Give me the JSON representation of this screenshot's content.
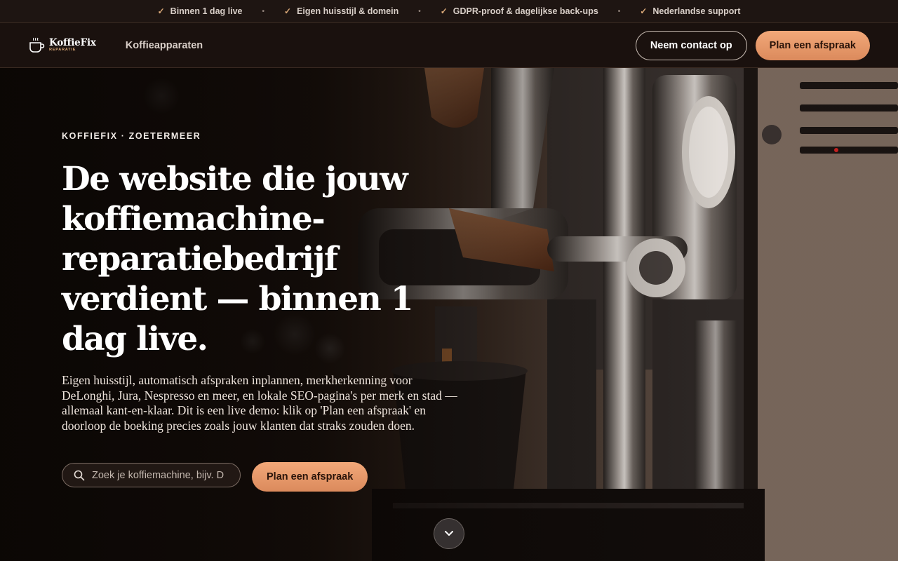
{
  "topbar": {
    "items": [
      "Binnen 1 dag live",
      "Eigen huisstijl & domein",
      "GDPR-proof & dagelijkse back-ups",
      "Nederlandse support"
    ],
    "separator": "•"
  },
  "nav": {
    "logo_name": "KoffieFix",
    "logo_sub": "REPARATIE",
    "link": "Koffieapparaten",
    "contact_label": "Neem contact op",
    "cta_label": "Plan een afspraak"
  },
  "hero": {
    "eyebrow": "KOFFIEFIX · ZOETERMEER",
    "headline": "De website die jouw koffiemachine-reparatiebedrijf verdient — binnen 1 dag live.",
    "lead": "Eigen huisstijl, automatisch afspraken inplannen, merkherkenning voor DeLonghi, Jura, Nespresso en meer, en lokale SEO-pagina's per merk en stad — allemaal kant-en-klaar. Dit is een live demo: klik op 'Plan een afspraak' en doorloop de boeking precies zoals jouw klanten dat straks zouden doen.",
    "search_placeholder": "Zoek je koffiemachine, bijv. D",
    "cta_label": "Plan een afspraak"
  },
  "colors": {
    "accent": "#e89a6b",
    "background": "#1a110e",
    "check": "#d9a878"
  },
  "icons": {
    "check": "check-icon",
    "search": "search-icon",
    "scroll": "chevron-down-icon",
    "logo": "coffee-cup-icon"
  }
}
